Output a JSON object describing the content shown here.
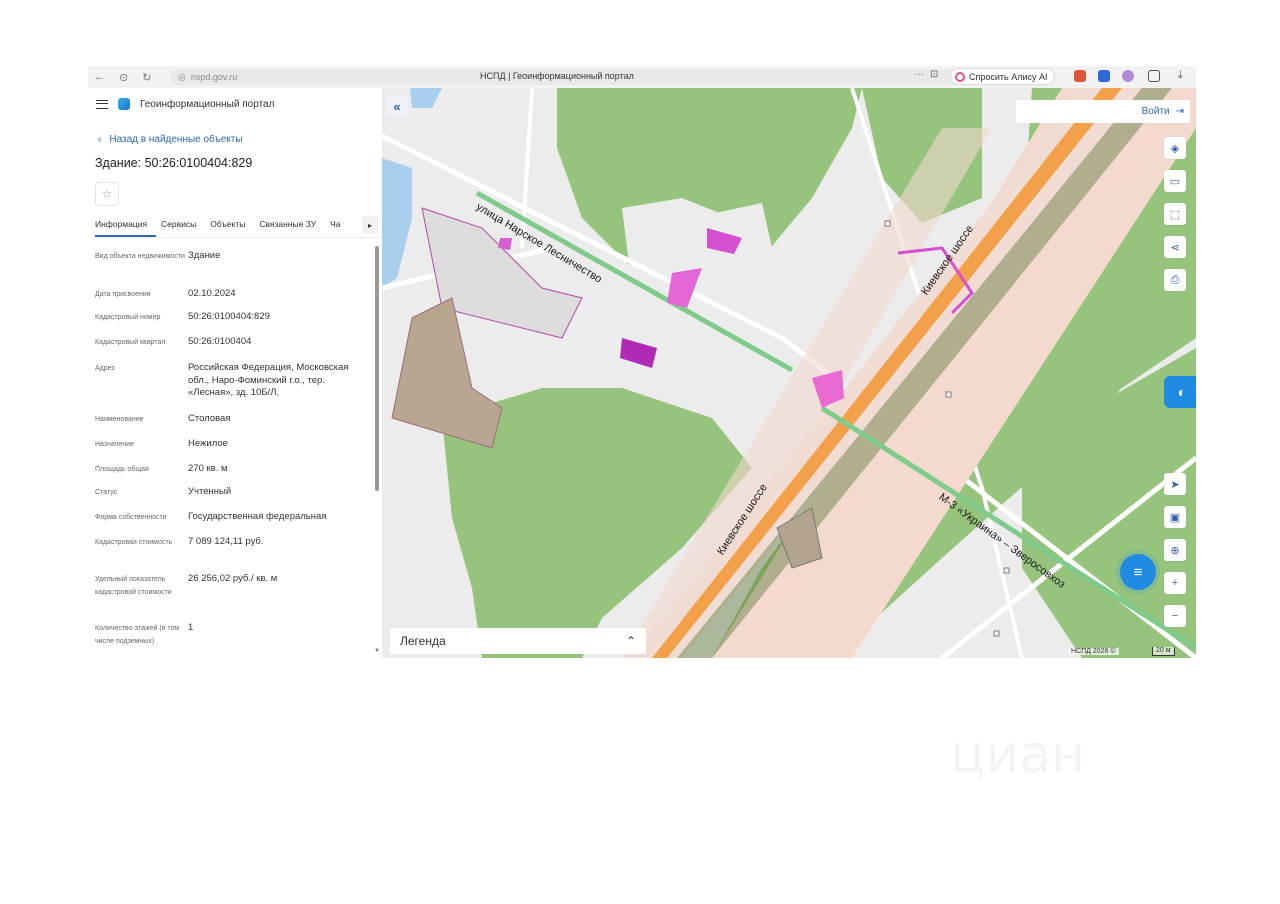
{
  "browser": {
    "url": "nspd.gov.ru",
    "tab_title": "НСПД | Геоинформационный портал",
    "alice_button": "Спросить Алису AI",
    "nav_back_icon": "arrow-left-icon",
    "dots": "···"
  },
  "app": {
    "title": "Геоинформационный портал",
    "back_link": "Назад в найденные объекты",
    "object_title": "Здание: 50:26:0100404:829"
  },
  "tabs": [
    "Информация",
    "Сервисы",
    "Объекты",
    "Связанные ЗУ",
    "Ча"
  ],
  "fields": [
    {
      "label": "Вид объекта недвижимости",
      "value": "Здание"
    },
    {
      "label": "Дата присвоения",
      "value": "02.10.2024"
    },
    {
      "label": "Кадастровый номер",
      "value": "50:26:0100404:829"
    },
    {
      "label": "Кадастровый квартал",
      "value": "50:26:0100404"
    },
    {
      "label": "Адрес",
      "value": "Российская Федерация, Московская обл., Наро-Фоминский г.о., тер. «Лесная», зд. 10Б/Л."
    },
    {
      "label": "Наименование",
      "value": "Столовая"
    },
    {
      "label": "Назначение",
      "value": "Нежилое"
    },
    {
      "label": "Площадь общая",
      "value": "270 кв. м"
    },
    {
      "label": "Статус",
      "value": "Учтенный"
    },
    {
      "label": "Форма собственности",
      "value": "Государственная федеральная"
    },
    {
      "label": "Кадастровая стоимость",
      "value": "7 089 124,11 руб."
    },
    {
      "label": "Удельный показатель кадастровой стоимости",
      "value": "26 256,02 руб./ кв. м"
    },
    {
      "label": "Количество этажей (в том числе подземных)",
      "value": "1"
    }
  ],
  "map": {
    "login_label": "Войти",
    "legend_label": "Легенда",
    "attribution": "НСПД 2026 ©",
    "scale": "20 м",
    "labels": {
      "street": "улица Нарское Лесничество",
      "highway_top": "Киевское шоссе",
      "highway_bottom": "Киевское шоссе",
      "m3": "М-3 «Украина» – Зверосовхоз"
    }
  },
  "watermark": "циан",
  "colors": {
    "accent": "#2f68b4",
    "forest": "#96c47c",
    "highway": "#f2a04a",
    "parcel": "#e24fc9"
  }
}
